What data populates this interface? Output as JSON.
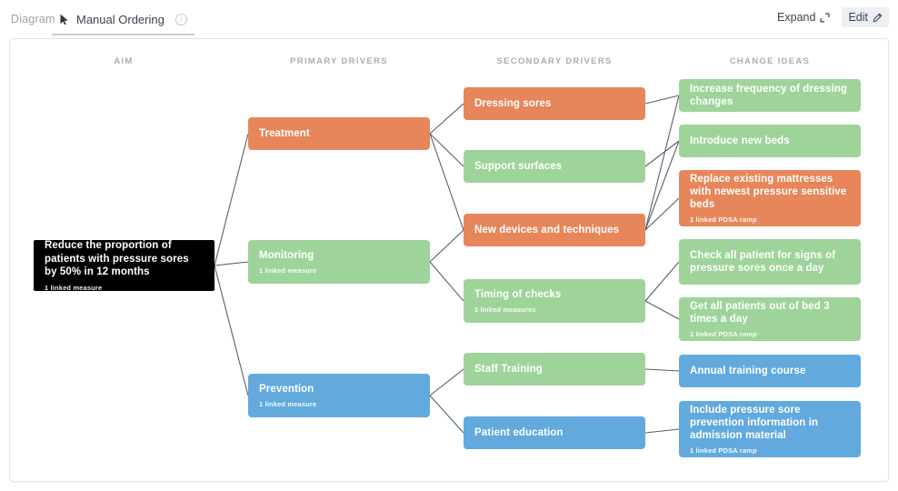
{
  "breadcrumb": "Diagram",
  "tab": {
    "label": "Manual Ordering",
    "cursor_icon": "cursor-arrow-icon",
    "info_icon": "info-icon"
  },
  "toolbar": {
    "expand_label": "Expand",
    "expand_icon": "expand-corners-icon",
    "edit_label": "Edit",
    "edit_icon": "pencil-icon"
  },
  "columns": [
    {
      "label": "AIM"
    },
    {
      "label": "PRIMARY DRIVERS"
    },
    {
      "label": "SECONDARY DRIVERS"
    },
    {
      "label": "CHANGE IDEAS"
    }
  ],
  "colors": {
    "orange": "#e8865b",
    "green": "#9ed49a",
    "blue": "#62aade",
    "aim": "#000000",
    "connector": "#575e6e"
  },
  "aim": {
    "title": "Reduce the proportion of patients with pressure sores by 50% in 12 months",
    "sub": "1 linked measure"
  },
  "primary_drivers": [
    {
      "title": "Treatment",
      "sub": "",
      "color": "orange"
    },
    {
      "title": "Monitoring",
      "sub": "1 linked measure",
      "color": "green"
    },
    {
      "title": "Prevention",
      "sub": "1 linked measure",
      "color": "blue"
    }
  ],
  "secondary_drivers": [
    {
      "title": "Dressing sores",
      "sub": "",
      "color": "orange"
    },
    {
      "title": "Support surfaces",
      "sub": "",
      "color": "green"
    },
    {
      "title": "New devices and techniques",
      "sub": "",
      "color": "orange"
    },
    {
      "title": "Timing of checks",
      "sub": "2 linked measures",
      "color": "green"
    },
    {
      "title": "Staff Training",
      "sub": "",
      "color": "green"
    },
    {
      "title": "Patient education",
      "sub": "",
      "color": "blue"
    }
  ],
  "change_ideas": [
    {
      "title": "Increase frequency of dressing changes",
      "sub": "",
      "color": "green"
    },
    {
      "title": "Introduce new beds",
      "sub": "",
      "color": "green"
    },
    {
      "title": "Replace existing mattresses with newest pressure sensitive beds",
      "sub": "1 linked PDSA ramp",
      "color": "orange"
    },
    {
      "title": "Check all patient for signs of pressure sores once a day",
      "sub": "",
      "color": "green"
    },
    {
      "title": "Get all patients out of bed 3 times a day",
      "sub": "1 linked PDSA ramp",
      "color": "green"
    },
    {
      "title": "Annual training course",
      "sub": "",
      "color": "blue"
    },
    {
      "title": "Include pressure sore prevention information in admission material",
      "sub": "1 linked PDSA ramp",
      "color": "blue"
    }
  ]
}
